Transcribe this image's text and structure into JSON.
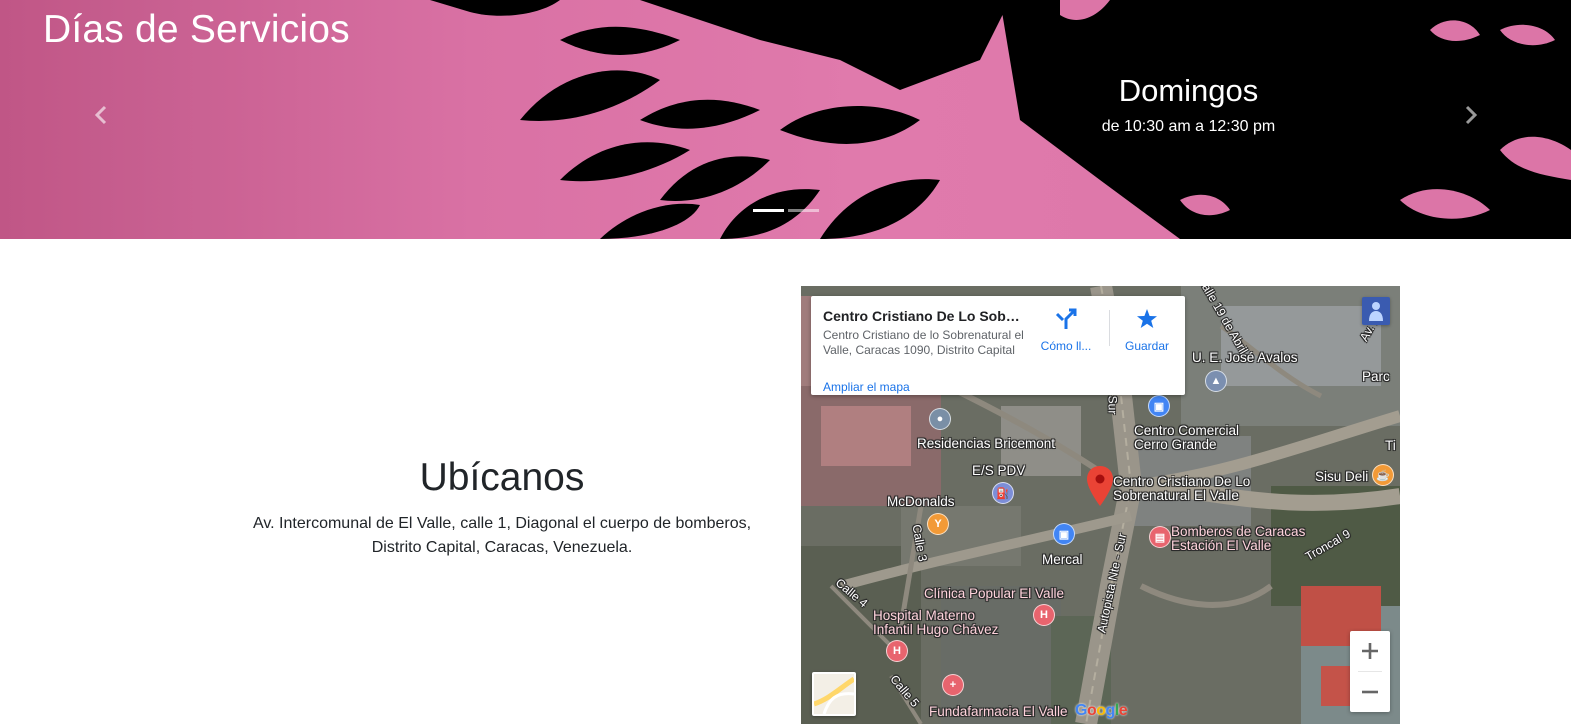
{
  "hero": {
    "title": "Días de Servicios",
    "slide": {
      "title": "Domingos",
      "text": "de 10:30 am a 12:30 pm"
    },
    "prev_icon": "chevron-left-icon",
    "next_icon": "chevron-right-icon",
    "indicators": 2,
    "active_indicator": 1
  },
  "location": {
    "title": "Ubícanos",
    "address": "Av. Intercomunal de El Valle, calle 1, Diagonal el cuerpo de bomberos, Distrito Capital, Caracas, Venezuela."
  },
  "map": {
    "place_name": "Centro Cristiano De Lo Sobren...",
    "place_address": "Centro Cristiano de lo Sobrenatural el Valle, Caracas 1090, Distrito Capital",
    "directions_label": "Cómo ll...",
    "save_label": "Guardar",
    "enlarge_label": "Ampliar el mapa",
    "zoom_in": "+",
    "zoom_out": "−",
    "logo": "Google",
    "labels": {
      "school": "U. E. José Avalos",
      "park": "Parc",
      "residences": "Residencias Bricemont",
      "mall_1": "Centro Comercial",
      "mall_2": "Cerro Grande",
      "ti": "Ti",
      "gas": "E/S PDV",
      "church_1": "Centro Cristiano De Lo",
      "church_2": "Sobrenatural El Valle",
      "sisu": "Sisu Deli",
      "mcdonalds": "McDonalds",
      "firefighters_1": "Bomberos de Caracas",
      "firefighters_2": "Estación El Valle",
      "mercal": "Mercal",
      "clinic": "Clínica Popular El Valle",
      "hospital_1": "Hospital Materno",
      "hospital_2": "Infantil Hugo Chávez",
      "pharmacy": "Fundafarmacia El Valle",
      "calle3": "Calle 3",
      "calle4": "Calle 4",
      "calle5": "Calle 5",
      "autopista": "Autopista Nte - Sur",
      "sur": "Sur",
      "troncal": "Troncal 9",
      "calle19": "Calle 19 de Abril",
      "av": "Av. Inte"
    }
  },
  "colors": {
    "hero_pink": "#ea7fb3",
    "link_blue": "#1a73e8",
    "pin_red": "#ea4335"
  }
}
